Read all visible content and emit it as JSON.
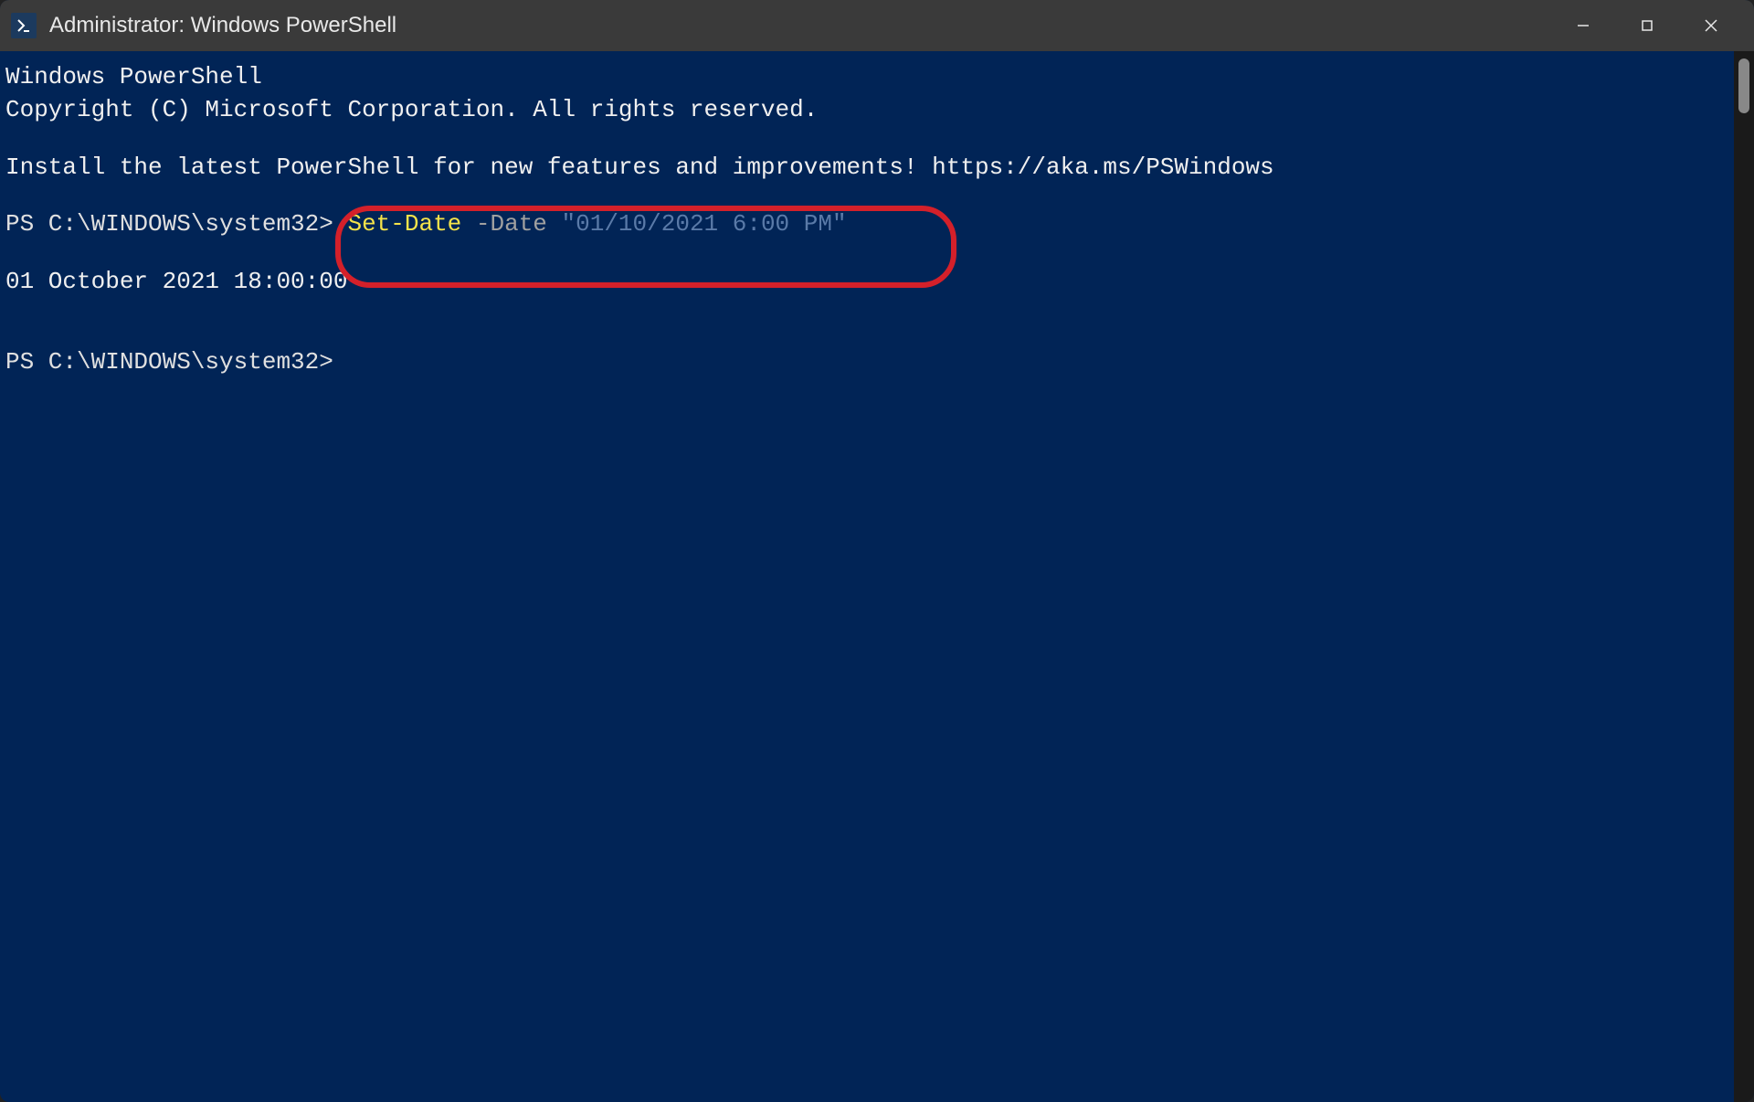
{
  "window": {
    "title": "Administrator: Windows PowerShell"
  },
  "terminal": {
    "line1": "Windows PowerShell",
    "line2": "Copyright (C) Microsoft Corporation. All rights reserved.",
    "install_msg": "Install the latest PowerShell for new features and improvements! https://aka.ms/PSWindows",
    "prompt1": "PS C:\\WINDOWS\\system32> ",
    "cmdlet": "Set-Date",
    "param": " -Date ",
    "arg": "\"01/10/2021 6:00 PM\"",
    "output": "01 October 2021 18:00:00",
    "prompt2": "PS C:\\WINDOWS\\system32>"
  }
}
